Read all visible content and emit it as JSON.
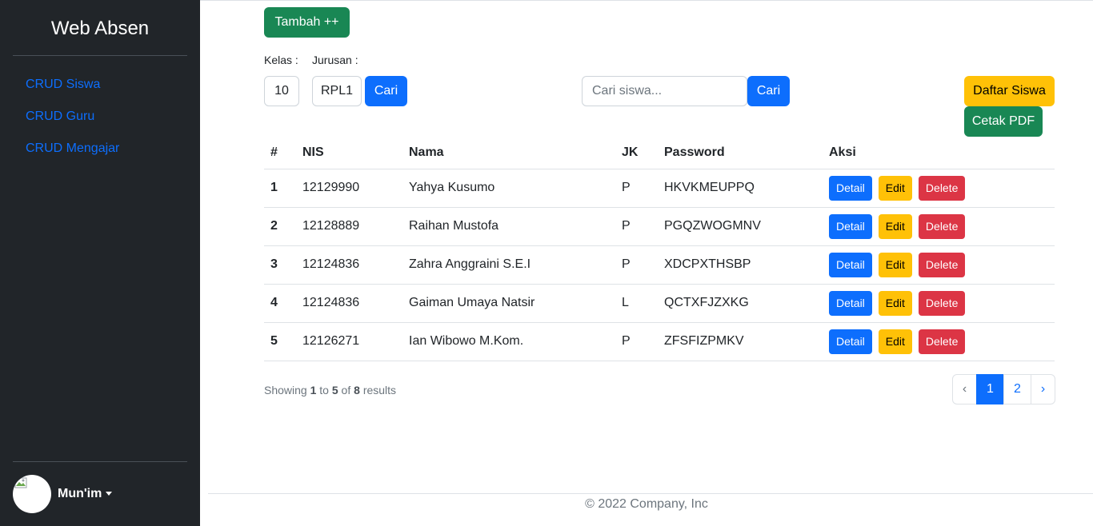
{
  "sidebar": {
    "brand": "Web Absen",
    "items": [
      {
        "label": "CRUD Siswa"
      },
      {
        "label": "CRUD Guru"
      },
      {
        "label": "CRUD Mengajar"
      }
    ],
    "user": {
      "name": "Mun'im"
    }
  },
  "toolbar": {
    "add_label": "Tambah ++",
    "kelas_label": "Kelas :",
    "jurusan_label": "Jurusan :",
    "kelas_value": "10",
    "jurusan_value": "RPL1",
    "filter_button": "Cari",
    "search_placeholder": "Cari siswa...",
    "search_button": "Cari",
    "daftar_button": "Daftar Siswa",
    "pdf_button": "Cetak PDF"
  },
  "table": {
    "headers": [
      "#",
      "NIS",
      "Nama",
      "JK",
      "Password",
      "Aksi"
    ],
    "actions": {
      "detail": "Detail",
      "edit": "Edit",
      "delete": "Delete"
    },
    "rows": [
      {
        "no": "1",
        "nis": "12129990",
        "nama": "Yahya Kusumo",
        "jk": "P",
        "password": "HKVKMEUPPQ"
      },
      {
        "no": "2",
        "nis": "12128889",
        "nama": "Raihan Mustofa",
        "jk": "P",
        "password": "PGQZWOGMNV"
      },
      {
        "no": "3",
        "nis": "12124836",
        "nama": "Zahra Anggraini S.E.I",
        "jk": "P",
        "password": "XDCPXTHSBP"
      },
      {
        "no": "4",
        "nis": "12124836",
        "nama": "Gaiman Umaya Natsir",
        "jk": "L",
        "password": "QCTXFJZXKG"
      },
      {
        "no": "5",
        "nis": "12126271",
        "nama": "Ian Wibowo M.Kom.",
        "jk": "P",
        "password": "ZFSFIZPMKV"
      }
    ]
  },
  "pagination": {
    "showing_prefix": "Showing",
    "from": "1",
    "to_word": "to",
    "to": "5",
    "of_word": "of",
    "total": "8",
    "results_word": "results",
    "prev": "‹",
    "pages": [
      "1",
      "2"
    ],
    "next": "›",
    "active_page": "1"
  },
  "footer": {
    "text": "© 2022 Company, Inc"
  },
  "colors": {
    "sidebar_bg": "#212529",
    "primary": "#0d6efd",
    "success": "#198754",
    "warning": "#ffc107",
    "danger": "#dc3545"
  }
}
